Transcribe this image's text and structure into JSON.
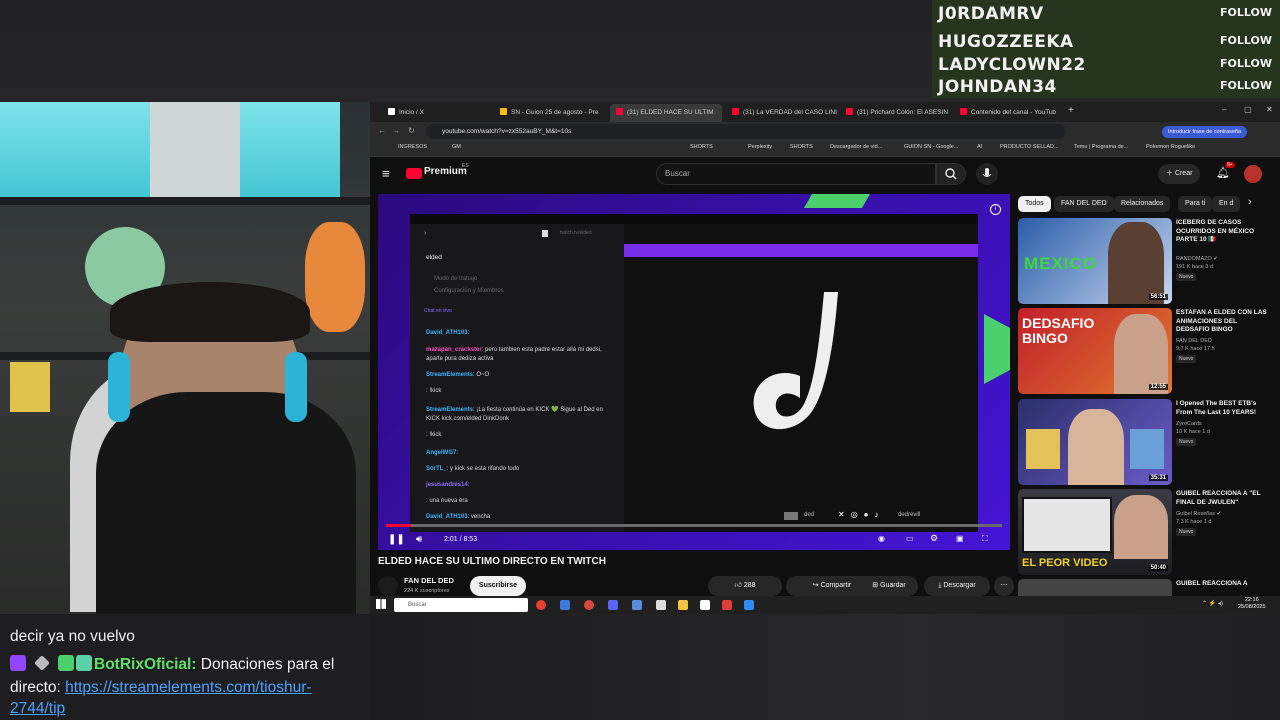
{
  "followers": [
    {
      "name": "J0RDAMRV",
      "button": "FOLLOW"
    },
    {
      "name": "HUGOZZEEKA",
      "button": "FOLLOW"
    },
    {
      "name": "LADYCLOWN22",
      "button": "FOLLOW"
    },
    {
      "name": "JOHNDAN34",
      "button": "FOLLOW"
    }
  ],
  "stream_chat": {
    "line1": "decir ya no vuelvo",
    "user": "BotRixOficial:",
    "message": "Donaciones para el",
    "message2": "directo:",
    "link_part1": "https://streamelements.com/tioshur-",
    "link_part2": "2744/tip"
  },
  "browser": {
    "tabs": [
      "Inicio / X",
      "SN - Guion 25 de agosto - Pre",
      "(31) ELDED HACE SU ULTIM",
      "(31) La VERDAD del CASO LINI",
      "(31) Prichard Colón: El ASESIN",
      "Contenido del canal - YouTub"
    ],
    "url": "youtube.com/watch?v=zx552auBY_M&t=10s",
    "password_prompt": "Introducir frase de contraseña",
    "bookmarks": [
      "INGRESOS",
      "GM",
      "SHORTS",
      "Perplexity",
      "SHORTS",
      "Descargador de vid...",
      "GUION SN - Google...",
      "AI",
      "PRODUCTO SELLAD...",
      "Temu | Programa de...",
      "Pokemon Roguelike"
    ]
  },
  "youtube": {
    "logo": "Premium",
    "logo_region": "ES",
    "search_placeholder": "Buscar",
    "create_label": "Crear",
    "notif_count": "9+",
    "time": "2:01 / 8:53",
    "video_title": "ELDED HACE SU ULTIMO DIRECTO EN TWITCH",
    "channel_name": "FAN DEL DED",
    "subscribers": "224 K suscriptores",
    "subscribe": "Suscribirse",
    "likes": "288",
    "share": "Compartir",
    "save": "Guardar",
    "download": "Descargar",
    "chips": [
      "Todos",
      "FAN DEL DED",
      "Relacionados",
      "Para ti",
      "En d"
    ],
    "recommendations": [
      {
        "title": "ICEBERG DE CASOS OCURRIDOS EN MÉXICO PARTE 10 🇲🇽",
        "channel": "RANDOMAZO ✔",
        "meta": "191 K  hace 3 d",
        "badge": "Nuevo",
        "duration": "56:51",
        "thumb_text": "MEXICO"
      },
      {
        "title": "ESTAFAN A ELDED CON LAS ANIMACIONES DEL DEDSAFIO BINGO",
        "channel": "FAN DEL DED",
        "meta": "9,7 K  hace 17 h",
        "badge": "Nuevo",
        "duration": "12:55",
        "thumb_text": "DEDSAFIO BINGO"
      },
      {
        "title": "I Opened The BEST ETB's From The Last 10 YEARS!",
        "channel": "ZyroCards",
        "meta": "10 K  hace 1 d",
        "badge": "Nuevo",
        "duration": "35:31",
        "thumb_text": ""
      },
      {
        "title": "GUIBEL REACCIONA A \"EL FINAL DE JWULEN\"",
        "channel": "Guibel Reseñas ✔",
        "meta": "7,3 K  hace 1 d",
        "badge": "Nuevo",
        "duration": "50:40",
        "thumb_text": "EL PEOR VIDEO"
      },
      {
        "title": "GUIBEL REACCIONA A",
        "channel": "",
        "meta": "",
        "badge": "",
        "duration": "",
        "thumb_text": ""
      }
    ]
  },
  "player_content": {
    "channel_header": "elded",
    "menu1": "Modo de trabajo",
    "menu2": "Configuración y Miembros",
    "chat_header": "Chat en vivo",
    "twitch_url": "twitch.tv/elded",
    "overlay_handle1": "ded",
    "overlay_handle2": "dedrevill",
    "messages": [
      {
        "user": "David_ATH103",
        "text": ":"
      },
      {
        "user": "mazapan_crackster",
        "text": ": pero tambien esta padre estar allá mi dedsi, aparte pura dediza activa"
      },
      {
        "user": "StreamElements",
        "text": ": O~O"
      },
      {
        "user": "",
        "text": ": !kick"
      },
      {
        "user": "StreamElements",
        "text": ": ¡La fiesta continúa en KICK 💚 Sigue al Ded en KICK kick.com/elded DinkDonk"
      },
      {
        "user": "",
        "text": ": !kick"
      },
      {
        "user": "AngelWG7",
        "text": ":"
      },
      {
        "user": "SorTL_",
        "text": ": y kick se esta rifando todo"
      },
      {
        "user": "jesusandres14",
        "text": ":"
      },
      {
        "user": "",
        "text": ": una nueva era"
      },
      {
        "user": "David_ATH103",
        "text": ": vencha"
      }
    ]
  },
  "taskbar": {
    "search": "Buscar",
    "time": "22:16",
    "date": "25/08/2025"
  },
  "colors": {
    "player_frame": "#3a0fb8",
    "follower_bg": "#26351e",
    "accent_green": "#4bd06b",
    "link": "#4aa3ff"
  }
}
